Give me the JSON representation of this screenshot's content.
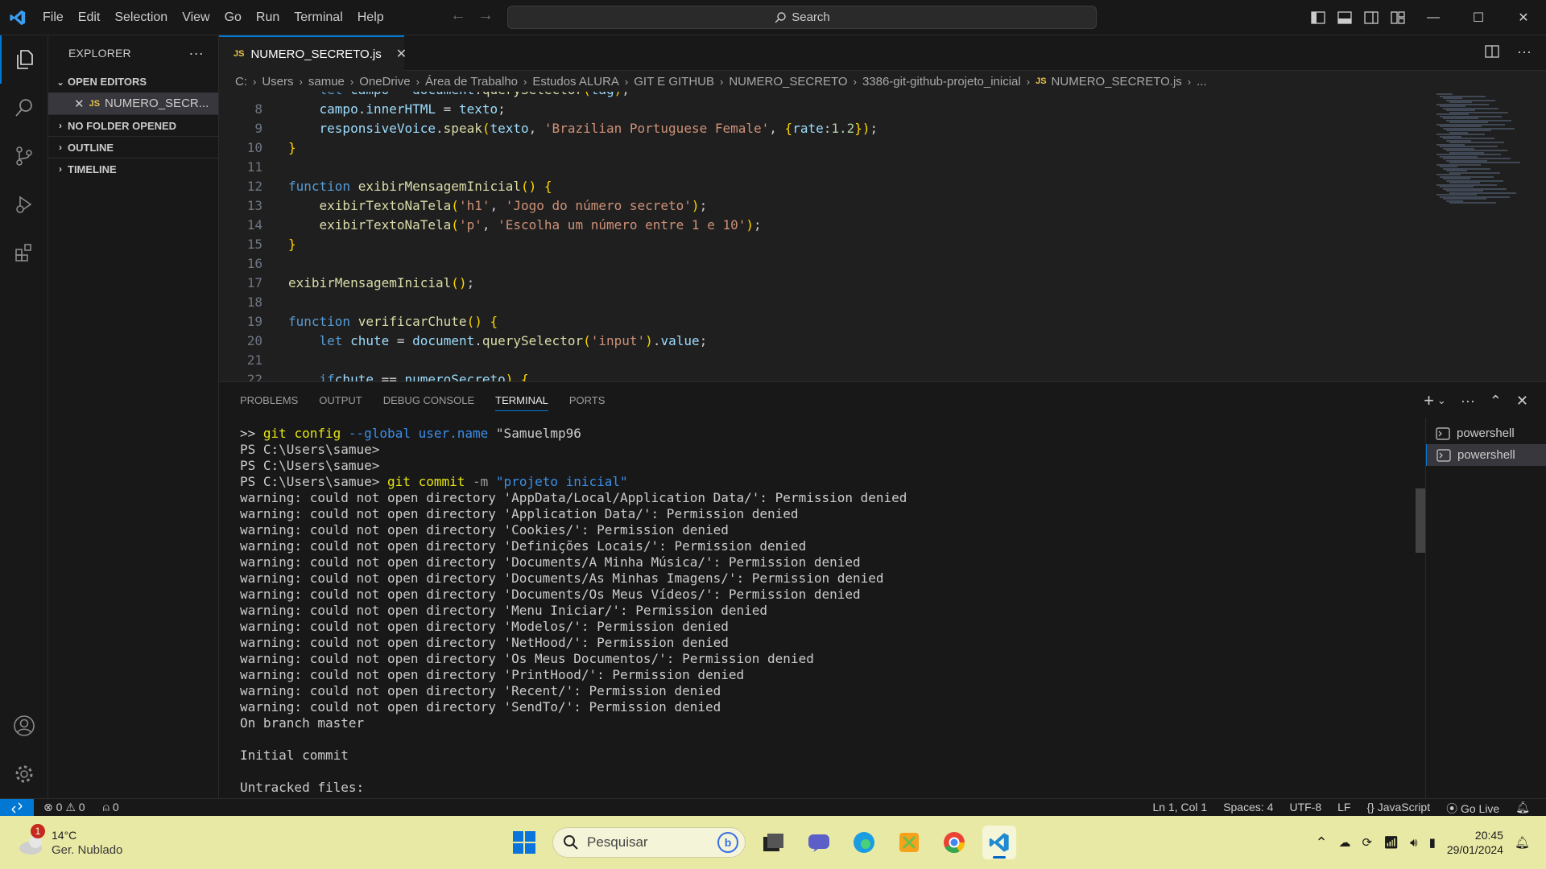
{
  "menu": [
    "File",
    "Edit",
    "Selection",
    "View",
    "Go",
    "Run",
    "Terminal",
    "Help"
  ],
  "search": {
    "label": "Search"
  },
  "sidebar": {
    "title": "EXPLORER",
    "open_editors": "OPEN EDITORS",
    "open_file": "NUMERO_SECR...",
    "no_folder": "NO FOLDER OPENED",
    "outline": "OUTLINE",
    "timeline": "TIMELINE"
  },
  "tab": {
    "badge": "JS",
    "label": "NUMERO_SECRETO.js"
  },
  "breadcrumb": [
    "C:",
    "Users",
    "samue",
    "OneDrive",
    "Área de Trabalho",
    "Estudos ALURA",
    "GIT E GITHUB",
    "NUMERO_SECRETO",
    "3386-git-github-projeto_inicial",
    "NUMERO_SECRETO.js",
    "..."
  ],
  "editor": {
    "lines": [
      {
        "n": "",
        "t": "    let campo = document.querySelector(tag);"
      },
      {
        "n": "8",
        "t": "    campo.innerHTML = texto;"
      },
      {
        "n": "9",
        "t": "    responsiveVoice.speak(texto, 'Brazilian Portuguese Female', {rate:1.2});"
      },
      {
        "n": "10",
        "t": "}"
      },
      {
        "n": "11",
        "t": ""
      },
      {
        "n": "12",
        "t": "function exibirMensagemInicial() {"
      },
      {
        "n": "13",
        "t": "    exibirTextoNaTela('h1', 'Jogo do número secreto');"
      },
      {
        "n": "14",
        "t": "    exibirTextoNaTela('p', 'Escolha um número entre 1 e 10');"
      },
      {
        "n": "15",
        "t": "}"
      },
      {
        "n": "16",
        "t": ""
      },
      {
        "n": "17",
        "t": "exibirMensagemInicial();"
      },
      {
        "n": "18",
        "t": ""
      },
      {
        "n": "19",
        "t": "function verificarChute() {"
      },
      {
        "n": "20",
        "t": "    let chute = document.querySelector('input').value;"
      },
      {
        "n": "21",
        "t": ""
      },
      {
        "n": "22",
        "t": "    if (chute == numeroSecreto) {"
      }
    ]
  },
  "panel": {
    "tabs": [
      "PROBLEMS",
      "OUTPUT",
      "DEBUG CONSOLE",
      "TERMINAL",
      "PORTS"
    ],
    "active_tab": "TERMINAL",
    "terminal_lines": [
      ">> git config --global user.name \"Samuelmp96",
      "PS C:\\Users\\samue>",
      "PS C:\\Users\\samue>",
      "PS C:\\Users\\samue> git commit -m \"projeto inicial\"",
      "warning: could not open directory 'AppData/Local/Application Data/': Permission denied",
      "warning: could not open directory 'Application Data/': Permission denied",
      "warning: could not open directory 'Cookies/': Permission denied",
      "warning: could not open directory 'Definições Locais/': Permission denied",
      "warning: could not open directory 'Documents/A Minha Música/': Permission denied",
      "warning: could not open directory 'Documents/As Minhas Imagens/': Permission denied",
      "warning: could not open directory 'Documents/Os Meus Vídeos/': Permission denied",
      "warning: could not open directory 'Menu Iniciar/': Permission denied",
      "warning: could not open directory 'Modelos/': Permission denied",
      "warning: could not open directory 'NetHood/': Permission denied",
      "warning: could not open directory 'Os Meus Documentos/': Permission denied",
      "warning: could not open directory 'PrintHood/': Permission denied",
      "warning: could not open directory 'Recent/': Permission denied",
      "warning: could not open directory 'SendTo/': Permission denied",
      "On branch master",
      "",
      "Initial commit",
      "",
      "Untracked files:"
    ],
    "terminals": [
      "powershell",
      "powershell"
    ]
  },
  "status": {
    "errors": "0",
    "warnings": "0",
    "ports": "0",
    "position": "Ln 1, Col 1",
    "spaces": "Spaces: 4",
    "encoding": "UTF-8",
    "eol": "LF",
    "language": "JavaScript",
    "golive": "Go Live"
  },
  "taskbar": {
    "weather_badge": "1",
    "temp": "14°C",
    "weather": "Ger. Nublado",
    "search_placeholder": "Pesquisar",
    "time": "20:45",
    "date": "29/01/2024"
  },
  "colors": {
    "accent": "#0078d4",
    "keyword": "#569cd6",
    "function": "#dcdcaa",
    "string": "#ce9178",
    "variable": "#9cdcfe",
    "bracket": "#ffd700"
  }
}
